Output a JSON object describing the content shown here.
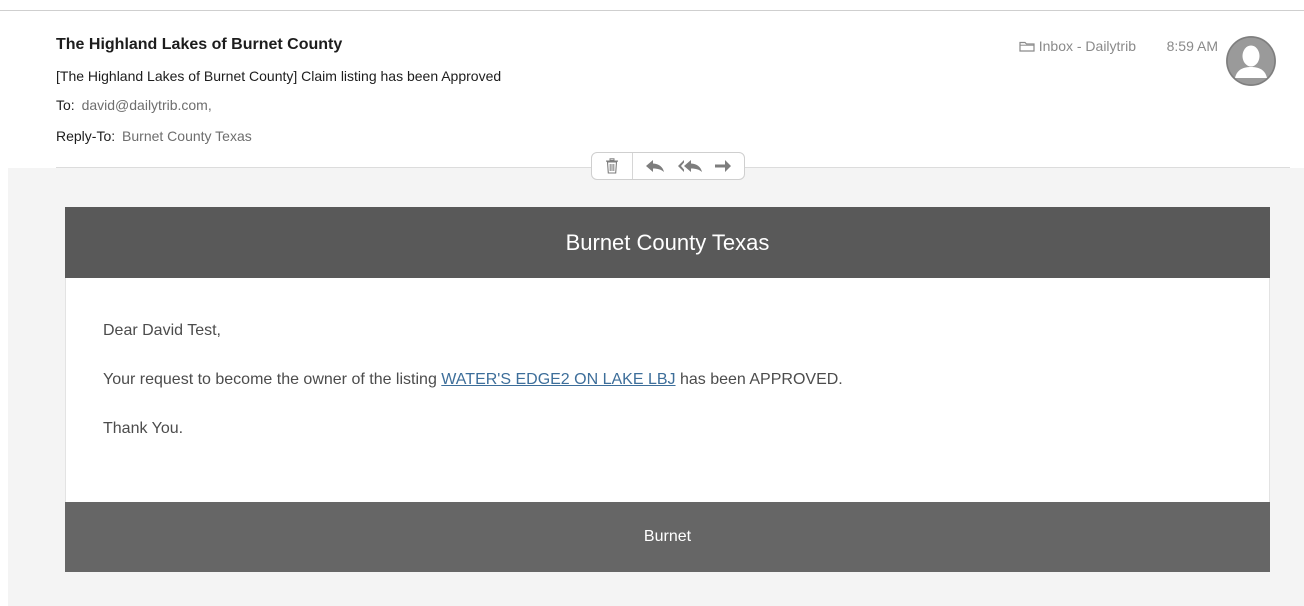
{
  "email": {
    "sender": "The Highland Lakes of Burnet County",
    "subject": "[The Highland Lakes of Burnet County] Claim listing has been Approved",
    "to_label": "To:",
    "to_value": "david@dailytrib.com,",
    "reply_to_label": "Reply-To:",
    "reply_to_value": "Burnet County Texas",
    "mailbox": "Inbox - Dailytrib",
    "time": "8:59 AM"
  },
  "toolbar": {
    "icons": [
      "trash-icon",
      "reply-icon",
      "reply-all-icon",
      "forward-icon"
    ]
  },
  "message": {
    "banner_title": "Burnet County Texas",
    "greeting": "Dear David Test,",
    "body_prefix": "Your request to become the owner of the listing",
    "listing_link": "WATER'S EDGE2 ON LAKE LBJ",
    "body_suffix": "has been APPROVED.",
    "closing": "Thank You.",
    "footer": "Burnet"
  },
  "colors": {
    "banner_bg": "#595959",
    "footer_bg": "#666666",
    "link": "#3d6e9a",
    "body_bg": "#f4f4f4"
  }
}
